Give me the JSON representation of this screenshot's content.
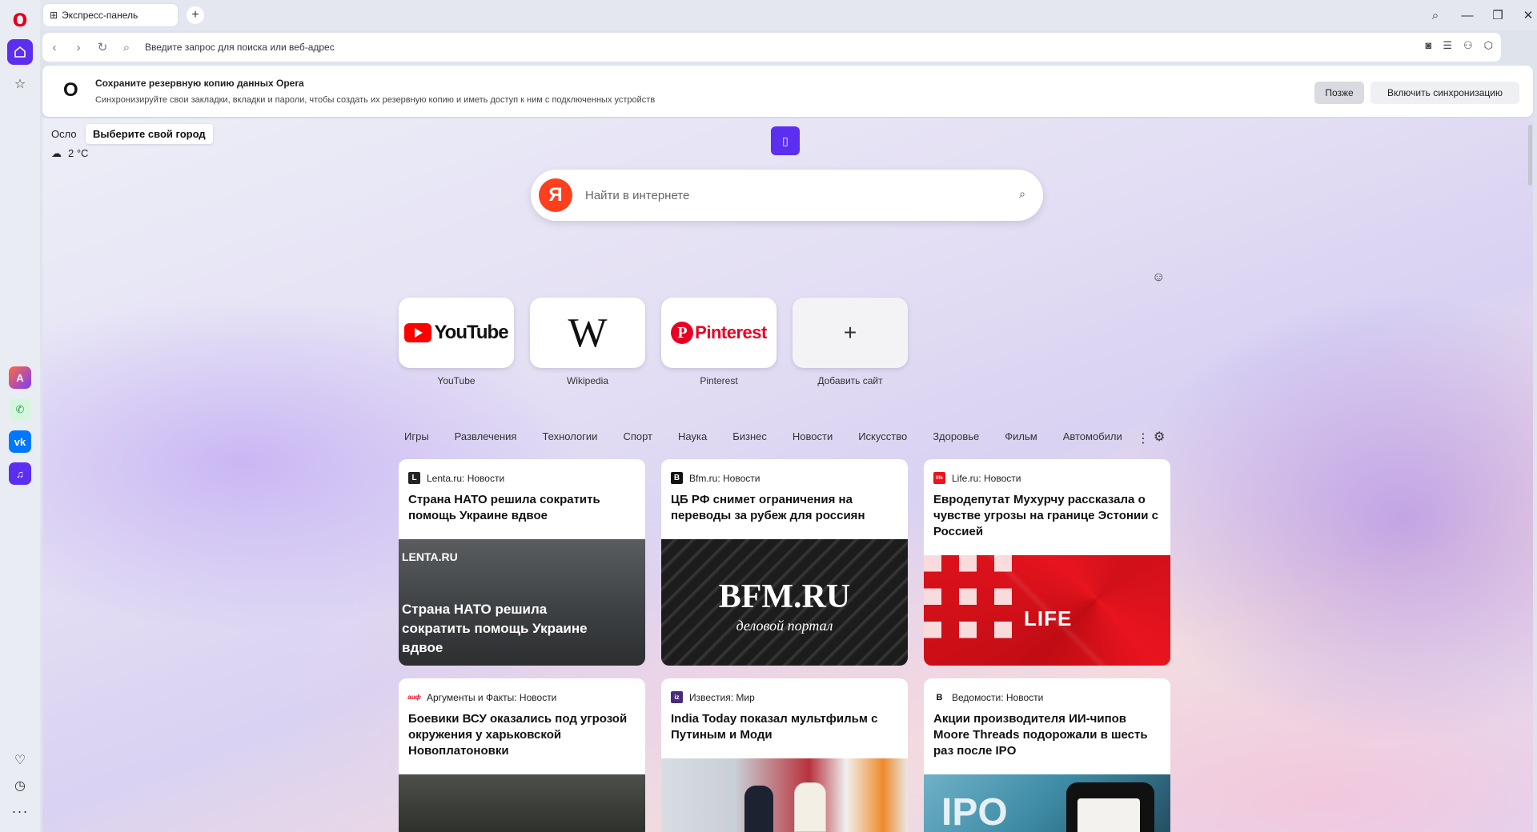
{
  "tab": {
    "title": "Экспресс-панель",
    "new_tab_symbol": "+"
  },
  "address_bar": {
    "placeholder": "Введите запрос для поиска или веб-адрес"
  },
  "banner": {
    "title": "Сохраните резервную копию данных Opera",
    "text": "Синхронизируйте свои закладки, вкладки и пароли, чтобы создать их резервную копию и иметь доступ к ним с подключенных устройств",
    "later_label": "Позже",
    "sync_label": "Включить синхронизацию"
  },
  "weather": {
    "city": "Осло",
    "tooltip": "Выберите свой город",
    "temp": "2 °C"
  },
  "search": {
    "placeholder": "Найти в интернете",
    "engine_letter": "Я"
  },
  "speed_dial": [
    {
      "label": "YouTube",
      "logo_text": "YouTube"
    },
    {
      "label": "Wikipedia",
      "logo_text": "W"
    },
    {
      "label": "Pinterest",
      "logo_text": "Pinterest"
    },
    {
      "label": "Добавить сайт",
      "logo_text": "+"
    }
  ],
  "categories": [
    "Игры",
    "Развлечения",
    "Технологии",
    "Спорт",
    "Наука",
    "Бизнес",
    "Новости",
    "Искусство",
    "Здоровье",
    "Фильм",
    "Автомобили"
  ],
  "news": [
    {
      "source": "Lenta.ru: Новости",
      "title": "Страна НАТО решила сократить помощь Украине вдвое",
      "img_brand": "LENTA.RU",
      "img_headline": "Страна НАТО решила сократить помощь Украине вдвое"
    },
    {
      "source": "Bfm.ru: Новости",
      "title": "ЦБ РФ снимет ограничения на переводы за рубеж для россиян",
      "img_brand": "BFM.RU",
      "img_sub": "деловой портал"
    },
    {
      "source": "Life.ru: Новости",
      "title": "Евродепутат Мухурчу рассказала о чувстве угрозы на границе Эстонии с Россией",
      "img_brand": "LIFE"
    },
    {
      "source": "Аргументы и Факты: Новости",
      "title": "Боевики ВСУ оказались под угрозой окружения у харьковской Новоплатоновки"
    },
    {
      "source": "Известия: Мир",
      "title": "India Today показал мультфильм с Путиным и Моди"
    },
    {
      "source": "Ведомости: Новости",
      "title": "Акции производителя ИИ-чипов Moore Threads подорожали в шесть раз после IPO",
      "img_brand": "IPO"
    }
  ],
  "source_icons": [
    "L",
    "B",
    "life",
    "аиф",
    "iz",
    "B"
  ],
  "icons": {
    "sidebar": [
      "opera-logo-icon",
      "home-icon",
      "star-icon",
      "aria-icon",
      "whatsapp-icon",
      "vk-icon",
      "music-icon",
      "heart-icon",
      "clock-icon",
      "more-icon"
    ],
    "toolbar": [
      "back-icon",
      "forward-icon",
      "reload-icon",
      "search-icon",
      "camera-icon",
      "menu-icon",
      "profile-icon",
      "extension-icon"
    ]
  },
  "colors": {
    "accent": "#5b2ef0",
    "yandex": "#fc3f1d",
    "youtube": "#ff0000",
    "pinterest": "#e60023"
  }
}
